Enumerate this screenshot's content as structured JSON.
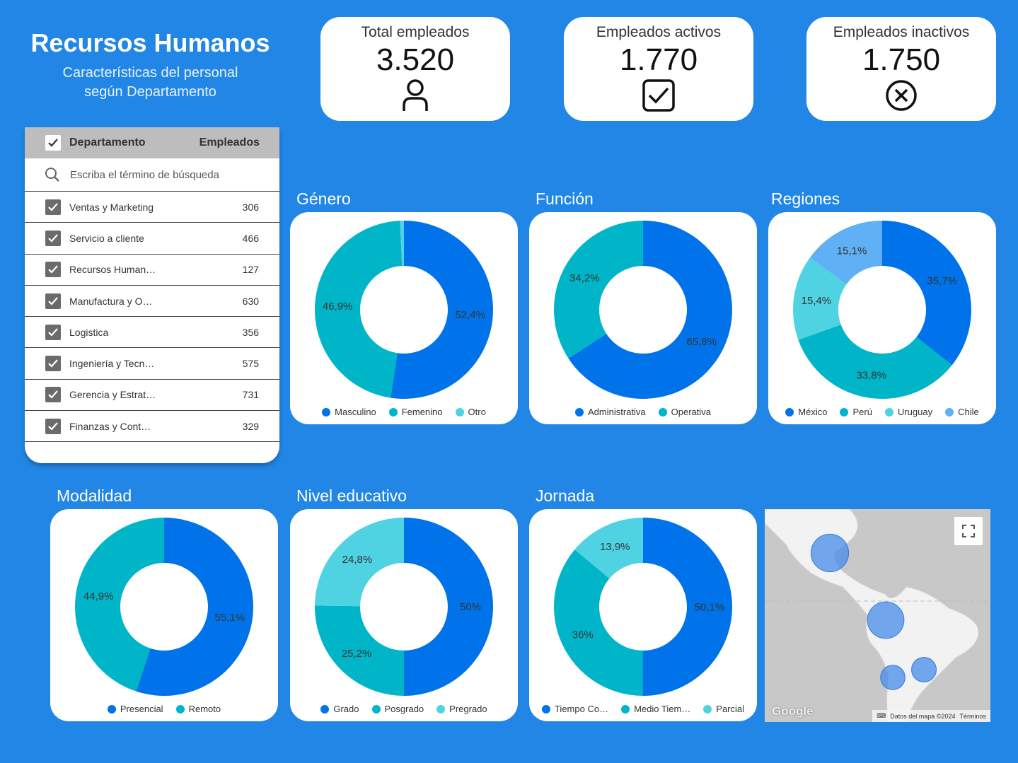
{
  "header": {
    "title": "Recursos Humanos",
    "subtitle": "Características del personal\nsegún Departamento"
  },
  "kpis": [
    {
      "label": "Total empleados",
      "value": "3.520",
      "icon": "person-icon"
    },
    {
      "label": "Empleados activos",
      "value": "1.770",
      "icon": "checkbox-checked-icon"
    },
    {
      "label": "Empleados inactivos",
      "value": "1.750",
      "icon": "x-circle-icon"
    }
  ],
  "table": {
    "col_department": "Departamento",
    "col_employees": "Empleados",
    "search_placeholder": "Escriba el término de búsqueda",
    "rows": [
      {
        "name": "Ventas y Marketing",
        "count": "306"
      },
      {
        "name": "Servicio a cliente",
        "count": "466"
      },
      {
        "name": "Recursos Humanos",
        "count": "127"
      },
      {
        "name": "Manufactura y Operacion…",
        "count": "630"
      },
      {
        "name": "Logistica",
        "count": "356"
      },
      {
        "name": "Ingeniería y Tecnología",
        "count": "575"
      },
      {
        "name": "Gerencia y Estrategia",
        "count": "731"
      },
      {
        "name": "Finanzas y Contabilidad",
        "count": "329"
      }
    ]
  },
  "colors": {
    "background": "#2286e6",
    "c1": "#0073ea",
    "c2": "#00b5c8",
    "c3": "#4fd2e2",
    "c4": "#5fb0f4"
  },
  "chart_data": [
    {
      "type": "pie",
      "title": "Género",
      "legend": "bottom",
      "categories": [
        "Masculino",
        "Femenino",
        "Otro"
      ],
      "values": [
        52.4,
        46.9,
        0.7
      ],
      "labels": [
        "52,4%",
        "46,9%",
        ""
      ]
    },
    {
      "type": "pie",
      "title": "Función",
      "legend": "bottom",
      "categories": [
        "Administrativa",
        "Operativa"
      ],
      "values": [
        65.8,
        34.2
      ],
      "labels": [
        "65,8%",
        "34,2%"
      ]
    },
    {
      "type": "pie",
      "title": "Regiones",
      "legend": "bottom",
      "categories": [
        "México",
        "Perú",
        "Uruguay",
        "Chile"
      ],
      "values": [
        35.7,
        33.8,
        15.4,
        15.1
      ],
      "labels": [
        "35,7%",
        "33,8%",
        "15,4%",
        "15,1%"
      ]
    },
    {
      "type": "pie",
      "title": "Modalidad",
      "legend": "bottom",
      "categories": [
        "Presencial",
        "Remoto"
      ],
      "values": [
        55.1,
        44.9
      ],
      "labels": [
        "55,1%",
        "44,9%"
      ]
    },
    {
      "type": "pie",
      "title": "Nivel educativo",
      "legend": "bottom",
      "categories": [
        "Grado",
        "Posgrado",
        "Pregrado"
      ],
      "values": [
        50,
        25.2,
        24.8
      ],
      "labels": [
        "50%",
        "25,2%",
        "24,8%"
      ]
    },
    {
      "type": "pie",
      "title": "Jornada",
      "legend": "bottom",
      "categories": [
        "Tiempo Co…",
        "Medio Tiem…",
        "Parcial"
      ],
      "values": [
        50.1,
        36,
        13.9
      ],
      "labels": [
        "50,1%",
        "36%",
        "13,9%"
      ]
    }
  ],
  "map": {
    "brand": "Google",
    "attribution": "Datos del mapa ©2024",
    "terms": "Términos",
    "bubbles": [
      {
        "region": "México"
      },
      {
        "region": "Perú"
      },
      {
        "region": "Chile"
      },
      {
        "region": "Uruguay"
      }
    ]
  }
}
